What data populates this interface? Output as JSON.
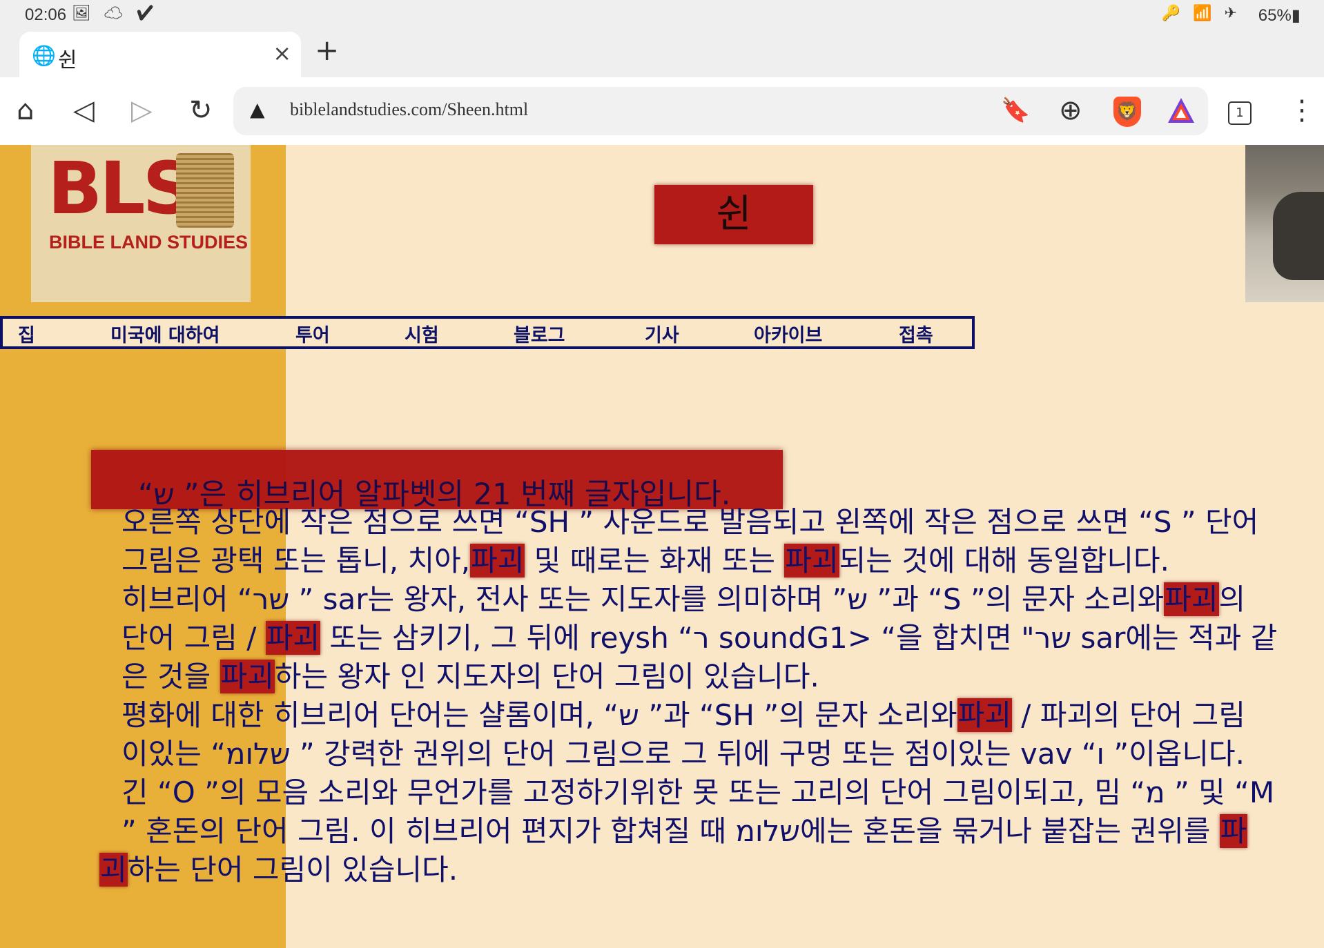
{
  "status_bar": {
    "time": "02:06",
    "left_icons": "🖼 ☁ ✔",
    "right_icons": "🔑 📶 ✈",
    "battery": "65%▮"
  },
  "tab": {
    "title": "쉰",
    "close": "×",
    "new_tab": "+"
  },
  "toolbar": {
    "home": "⌂",
    "back": "◁",
    "forward": "▷",
    "reload": "↻",
    "warning": "▲",
    "url": "biblelandstudies.com/Sheen.html",
    "bookmark": "🔖",
    "download": "⊕",
    "tab_count": "1",
    "menu": "⋮"
  },
  "logo": {
    "main": "BLS",
    "subtitle": "BIBLE LAND STUDIES"
  },
  "page_title": "쉰",
  "nav": [
    "집",
    "미국에 대하여",
    "투어",
    "시험",
    "블로그",
    "기사",
    "아카이브",
    "접촉"
  ],
  "intro": "“ש ”은 히브리어 알파벳의 21 번째 글자입니다.",
  "body": {
    "l1": "오른쪽 상단에 작은 점으로 쓰면 “SH ” 사운드로 발음되고 왼쪽에 작은 점으로 쓰면 “S ” 단어",
    "l2a": "그림은 광택 또는 톱니, 치아,",
    "hl": "파괴",
    "l2b": " 및 때로는 화재 또는 ",
    "l2c": "되는 것에 대해 동일합니다.",
    "l3a": "히브리어 “שר ” sar는 왕자, 전사 또는 지도자를 의미하며 ”ש ”과 “S ”의 문자 소리와",
    "l3b": "의",
    "l4a": "단어 그림 / ",
    "l4b": " 또는 삼키기, 그 뒤에 reysh “ר soundG1> “을 합치면 \"שר sar에는 적과 같",
    "l5a": "은 것을 ",
    "l5b": "하는 왕자 인 지도자의 단어 그림이 있습니다.",
    "l6a": "평화에 대한 히브리어 단어는 샬롬이며, “ש ”과 “SH ”의 문자 소리와",
    "l6b": " / 파괴의 단어 그림",
    "l7": "이있는 “שלומ ” 강력한 권위의 단어 그림으로 그 뒤에 구멍 또는 점이있는 vav “ו ”이옵니다.",
    "l8": "긴 “O ”의 모음 소리와 무언가를 고정하기위한 못 또는 고리의 단어 그림이되고, 밈 “מ ” 및 “M",
    "l9a": "” 혼돈의 단어 그림. 이 히브리어 편지가 합쳐질 때 שלומ에는 혼돈을 묶거나 붙잡는 권위를 ",
    "l9hl": "파",
    "l10hl": "괴",
    "l10b": "하는 단어 그림이 있습니다."
  }
}
